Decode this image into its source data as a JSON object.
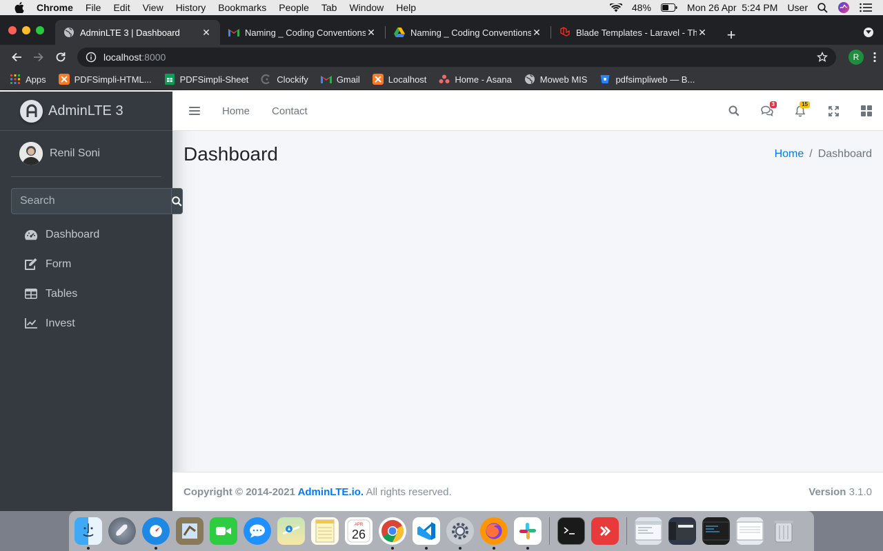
{
  "mac_menubar": {
    "app": "Chrome",
    "menus": [
      "File",
      "Edit",
      "View",
      "History",
      "Bookmarks",
      "People",
      "Tab",
      "Window",
      "Help"
    ],
    "battery": "48%",
    "datetime": "Mon 26 Apr  5:24 PM",
    "user": "User"
  },
  "chrome": {
    "tabs": [
      {
        "title": "AdminLTE 3 | Dashboard",
        "favicon": "globe-icon",
        "active": true
      },
      {
        "title": "Naming _ Coding Conventions",
        "favicon": "gmail-icon",
        "active": false
      },
      {
        "title": "Naming _ Coding Conventions",
        "favicon": "drive-icon",
        "active": false
      },
      {
        "title": "Blade Templates - Laravel - The",
        "favicon": "laravel-icon",
        "active": false
      }
    ],
    "url_host": "localhost",
    "url_port": ":8000",
    "profile_initial": "R",
    "bookmarks": [
      {
        "label": "Apps",
        "icon": "apps-grid-icon"
      },
      {
        "label": "PDFSimpli-HTML...",
        "icon": "xampp-icon"
      },
      {
        "label": "PDFSimpli-Sheet",
        "icon": "sheets-icon"
      },
      {
        "label": "Clockify",
        "icon": "clockify-icon"
      },
      {
        "label": "Gmail",
        "icon": "gmail-icon"
      },
      {
        "label": "Localhost",
        "icon": "xampp-icon"
      },
      {
        "label": "Home - Asana",
        "icon": "asana-icon"
      },
      {
        "label": "Moweb MIS",
        "icon": "globe-icon"
      },
      {
        "label": "pdfsimpliweb — B...",
        "icon": "bitbucket-icon"
      }
    ]
  },
  "sidebar": {
    "brand": "AdminLTE 3",
    "user_name": "Renil Soni",
    "search_placeholder": "Search",
    "items": [
      {
        "label": "Dashboard",
        "icon": "tachometer-icon"
      },
      {
        "label": "Form",
        "icon": "edit-icon"
      },
      {
        "label": "Tables",
        "icon": "table-icon"
      },
      {
        "label": "Invest",
        "icon": "chart-line-icon"
      }
    ]
  },
  "header": {
    "links": [
      "Home",
      "Contact"
    ],
    "messages_badge": "3",
    "notifications_badge": "15"
  },
  "content": {
    "title": "Dashboard",
    "breadcrumb_home": "Home",
    "breadcrumb_current": "Dashboard"
  },
  "footer": {
    "copyright_prefix": "Copyright © 2014-2021 ",
    "brand_link": "AdminLTE.io.",
    "rights": " All rights reserved.",
    "version_label": "Version",
    "version": " 3.1.0"
  },
  "colors": {
    "sidebar_bg": "#343a40",
    "link_blue": "#007bff",
    "badge_red": "#dc3545",
    "badge_yellow": "#ffc107"
  }
}
